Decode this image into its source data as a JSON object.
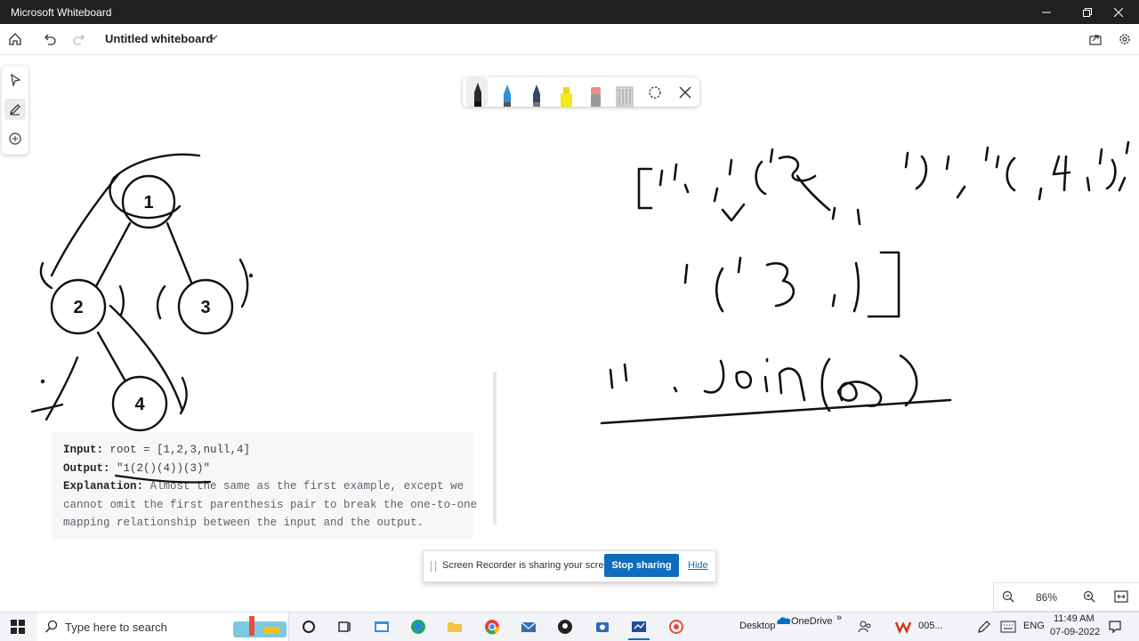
{
  "window": {
    "title": "Microsoft Whiteboard"
  },
  "header": {
    "board_title": "Untitled whiteboard"
  },
  "whiteboard": {
    "tree_nodes": [
      "1",
      "2",
      "3",
      "4"
    ]
  },
  "snippet": {
    "input_label": "Input:",
    "input_value": " root = [1,2,3,null,4]",
    "output_label": "Output:",
    "output_value": " \"1(2()(4))(3)\"",
    "explanation_label": "Explanation:",
    "explanation_line1": " Almost the same as the first example, except we",
    "explanation_line2": "cannot omit the first parenthesis pair to break the one-to-one",
    "explanation_line3": "mapping relationship between the input and the output."
  },
  "share_banner": {
    "message": "Screen Recorder is sharing your screen.",
    "stop_label": "Stop sharing",
    "hide_label": "Hide"
  },
  "zoom": {
    "level": "86%"
  },
  "taskbar": {
    "search_placeholder": "Type here to search",
    "desktop_label": "Desktop",
    "onedrive_label": "OneDrive",
    "app_badge_label": "005...",
    "language": "ENG",
    "time": "11:49 AM",
    "date": "07-09-2022"
  },
  "colors": {
    "accent": "#0f6cbd",
    "titlebar": "#202020",
    "ink": "#111111"
  }
}
